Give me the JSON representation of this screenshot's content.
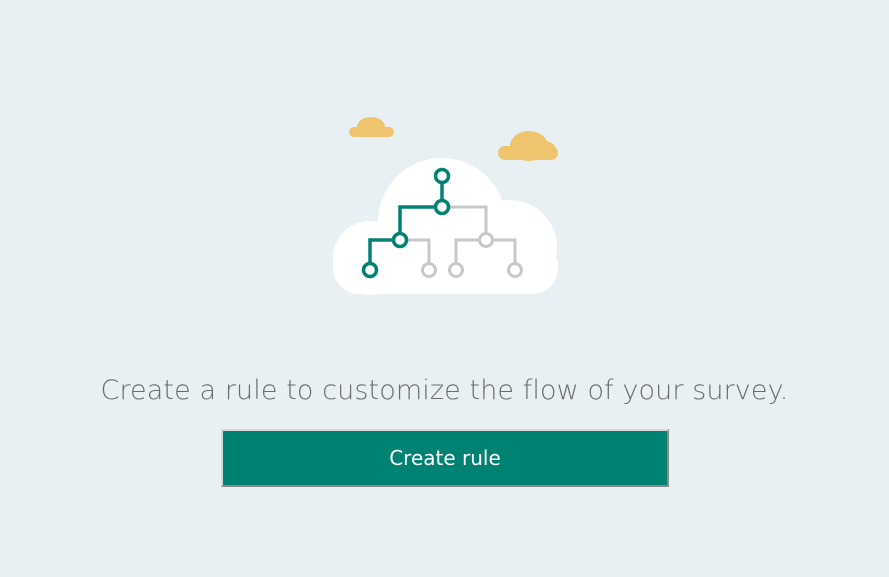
{
  "empty_state": {
    "message": "Create a rule to customize the flow of your survey.",
    "illustration": "cloud-branching-flow-illustration"
  },
  "actions": {
    "create_rule_label": "Create rule"
  },
  "colors": {
    "background": "#e8f0f3",
    "accent": "#008272",
    "cloud_small": "#efc46e",
    "cloud_main": "#ffffff",
    "inactive_branch": "#c8c8c8",
    "message_text": "#6b6b6b"
  }
}
